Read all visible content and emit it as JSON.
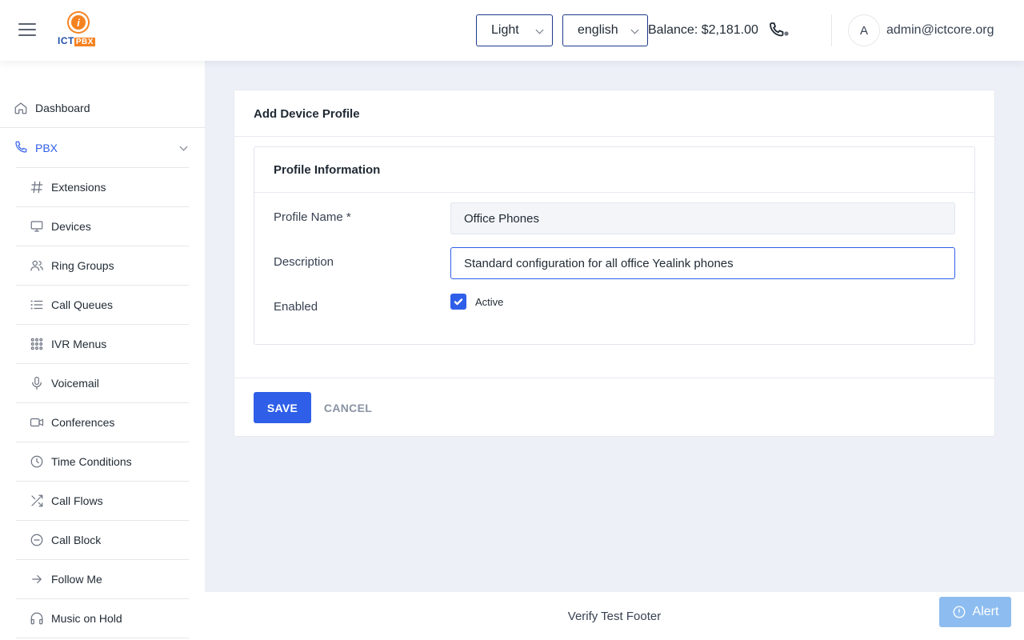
{
  "header": {
    "logo_ict": "ICT",
    "logo_pbx": "PBX",
    "logo_mark": "i",
    "theme_select": {
      "value": "Light"
    },
    "language_select": {
      "value": "english"
    },
    "balance": "Balance: $2,181.00",
    "avatar_initial": "A",
    "user_email": "admin@ictcore.org"
  },
  "sidebar": {
    "items": [
      {
        "label": "Dashboard",
        "icon": "home-icon"
      },
      {
        "label": "PBX",
        "icon": "phone-icon",
        "expanded": true,
        "active": true
      },
      {
        "label": "Extensions",
        "icon": "hash-icon"
      },
      {
        "label": "Devices",
        "icon": "monitor-icon"
      },
      {
        "label": "Ring Groups",
        "icon": "users-icon"
      },
      {
        "label": "Call Queues",
        "icon": "list-icon"
      },
      {
        "label": "IVR Menus",
        "icon": "grid-dots-icon"
      },
      {
        "label": "Voicemail",
        "icon": "microphone-icon"
      },
      {
        "label": "Conferences",
        "icon": "video-icon"
      },
      {
        "label": "Time Conditions",
        "icon": "clock-icon"
      },
      {
        "label": "Call Flows",
        "icon": "shuffle-icon"
      },
      {
        "label": "Call Block",
        "icon": "minus-circle-icon"
      },
      {
        "label": "Follow Me",
        "icon": "arrow-right-icon"
      },
      {
        "label": "Music on Hold",
        "icon": "headphones-icon"
      }
    ]
  },
  "main": {
    "card_title": "Add Device Profile",
    "section_title": "Profile Information",
    "fields": {
      "profile_name": {
        "label": "Profile Name *",
        "value": "Office Phones"
      },
      "description": {
        "label": "Description",
        "value": "Standard configuration for all office Yealink phones"
      },
      "enabled": {
        "label": "Enabled",
        "checkbox_label": "Active",
        "checked": true
      }
    },
    "save_label": "SAVE",
    "cancel_label": "CANCEL"
  },
  "footer": {
    "text": "Verify Test Footer"
  },
  "alert": {
    "label": "Alert"
  },
  "colors": {
    "primary": "#2f5fe8",
    "background": "#edf0f7",
    "alert": "#8dbdf0"
  }
}
